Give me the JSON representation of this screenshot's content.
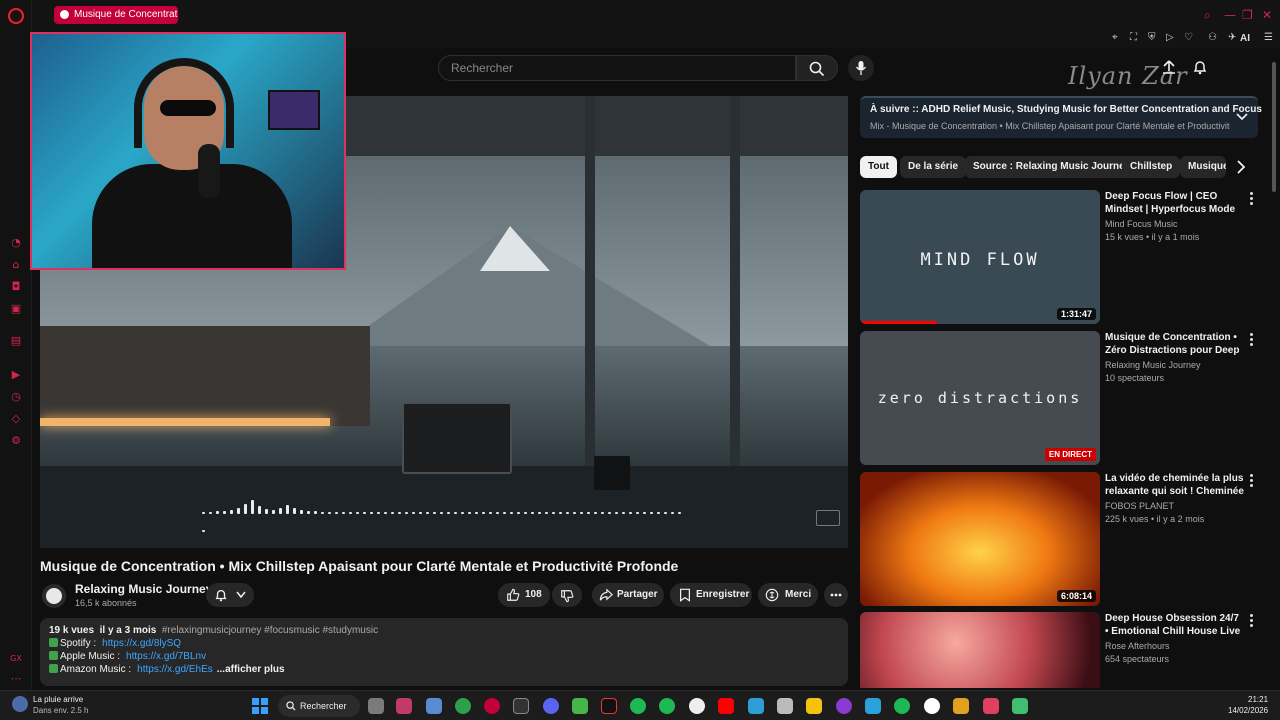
{
  "browser": {
    "tab_title": "Musique de Concentrat",
    "ai_label": "AI"
  },
  "search": {
    "placeholder": "Rechercher"
  },
  "header": {
    "signature": "Ilyan Zar"
  },
  "video": {
    "title": "Musique de Concentration • Mix Chillstep Apaisant pour Clarté Mentale et Productivité Profonde",
    "channel": "Relaxing Music Journey",
    "subscribers": "16,5 k abonnés",
    "likes": "108",
    "share_label": "Partager",
    "save_label": "Enregistrer",
    "thanks_label": "Merci"
  },
  "description": {
    "views": "19 k vues",
    "age": "il y a 3 mois",
    "hashtags": "#relaxingmusicjourney #focusmusic #studymusic",
    "links": [
      {
        "label": "Spotify :",
        "url": "https://x.gd/8lySQ"
      },
      {
        "label": "Apple Music :",
        "url": "https://x.gd/7BLnv"
      },
      {
        "label": "Amazon Music :",
        "url": "https://x.gd/EhEs"
      }
    ],
    "more_label": "...afficher plus"
  },
  "up_next": {
    "title": "À suivre :: ADHD Relief Music, Studying Music for Better Concentration and Focus",
    "subtitle": "Mix - Musique de Concentration • Mix Chillstep Apaisant pour Clarté Mentale et Productivité Pro..."
  },
  "chips": [
    "Tout",
    "De la série",
    "Source : Relaxing Music Journey",
    "Chillstep",
    "Musique"
  ],
  "recommendations": [
    {
      "title": "Deep Focus Flow | CEO Mindset | Hyperfocus Mode for Peak ...",
      "channel": "Mind Focus Music",
      "stats": "15 k vues • il y a 1 mois",
      "duration": "1:31:47",
      "thumb_text": "MIND FLOW",
      "thumb_color": "#3a4a55",
      "watched_fraction": 0.32
    },
    {
      "title": "Musique de Concentration • Zéro Distractions pour Deep Work, ...",
      "channel": "Relaxing Music Journey",
      "stats": "10 spectateurs",
      "live_badge": "EN DIRECT",
      "thumb_text": "zero distractions",
      "thumb_color": "#454b50"
    },
    {
      "title": "La vidéo de cheminée la plus relaxante qui soit ! Cheminée ...",
      "channel": "FOBOS PLANET",
      "stats": "225 k vues • il y a 2 mois",
      "duration": "6:08:14",
      "thumb_text": "",
      "thumb_color": "#b2360d"
    },
    {
      "title": "Deep House Obsession 24/7 • Emotional Chill House Live ...",
      "channel": "Rose Afterhours",
      "stats": "654 spectateurs",
      "thumb_text": "",
      "thumb_color": "#c0464f"
    }
  ],
  "taskbar": {
    "weather_title": "La pluie arrive",
    "weather_sub": "Dans env. 2.5 h",
    "search_label": "Rechercher",
    "time": "21:21",
    "date": "14/02/2026"
  },
  "colors": {
    "opera_accent": "#d0264b",
    "link": "#3ea6ff",
    "live_red": "#cc0000"
  }
}
